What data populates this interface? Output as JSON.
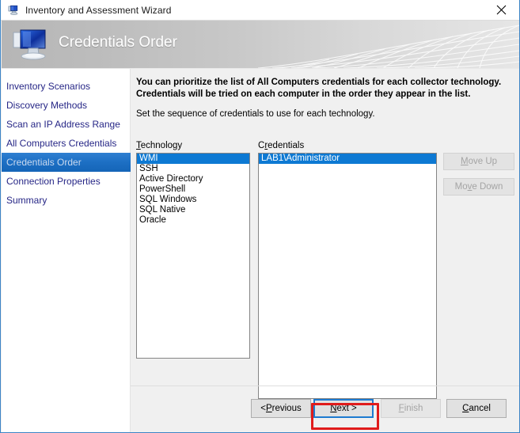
{
  "window": {
    "title": "Inventory and Assessment Wizard",
    "title_icon": "computer-wizard-icon",
    "close_icon": "close-icon"
  },
  "banner": {
    "heading": "Credentials Order",
    "icon": "computer-monitor-icon"
  },
  "sidebar": {
    "items": [
      {
        "label": "Inventory Scenarios",
        "selected": false
      },
      {
        "label": "Discovery Methods",
        "selected": false
      },
      {
        "label": "Scan an IP Address Range",
        "selected": false
      },
      {
        "label": "All Computers Credentials",
        "selected": false
      },
      {
        "label": "Credentials Order",
        "selected": true
      },
      {
        "label": "Connection Properties",
        "selected": false
      },
      {
        "label": "Summary",
        "selected": false
      }
    ]
  },
  "main": {
    "intro_line1": "You can prioritize the list of All Computers credentials for each collector technology.",
    "intro_line2": "Credentials will be tried on each computer in the order they appear in the list.",
    "subtitle": "Set the sequence of credentials to use for each technology.",
    "technology_label_pre": "",
    "technology_label_key": "T",
    "technology_label_post": "echnology",
    "credentials_label_pre": "C",
    "credentials_label_key": "r",
    "credentials_label_post": "edentials",
    "technology_items": [
      {
        "label": "WMI",
        "selected": true
      },
      {
        "label": "SSH",
        "selected": false
      },
      {
        "label": "Active Directory",
        "selected": false
      },
      {
        "label": "PowerShell",
        "selected": false
      },
      {
        "label": "SQL Windows",
        "selected": false
      },
      {
        "label": "SQL Native",
        "selected": false
      },
      {
        "label": "Oracle",
        "selected": false
      }
    ],
    "credentials_items": [
      {
        "label": "LAB1\\Administrator",
        "selected": true
      }
    ],
    "move_up": {
      "pre": "",
      "key": "M",
      "post": "ove Up",
      "enabled": false
    },
    "move_down": {
      "pre": "Mo",
      "key": "v",
      "post": "e Down",
      "enabled": false
    }
  },
  "footer": {
    "previous": {
      "pre": "< ",
      "key": "P",
      "post": "revious",
      "enabled": true
    },
    "next": {
      "pre": "",
      "key": "N",
      "post": "ext >",
      "enabled": true,
      "focused": true
    },
    "finish": {
      "pre": "",
      "key": "F",
      "post": "inish",
      "enabled": false
    },
    "cancel": {
      "pre": "",
      "key": "C",
      "post": "ancel",
      "enabled": true
    }
  },
  "annotation": {
    "target": "next-button",
    "color": "#e01b1b"
  }
}
